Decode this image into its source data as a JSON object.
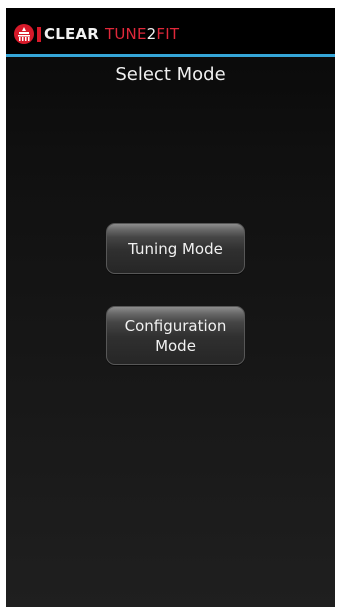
{
  "app": {
    "brand": {
      "clear": "CLEAR",
      "tune": "TUNE",
      "two": "2",
      "fit": "FIT"
    },
    "colors": {
      "header_background": "#000000",
      "accent_line": "#35a6d8",
      "brand_red": "#e0283a",
      "screen_background": "#141414",
      "button_fill": "#303030",
      "text": "#f0f0f0"
    },
    "logo_icon": "hearing-icon"
  },
  "screen": {
    "title": "Select Mode"
  },
  "modes": [
    {
      "label": "Tuning Mode"
    },
    {
      "label": "Configuration Mode"
    }
  ]
}
